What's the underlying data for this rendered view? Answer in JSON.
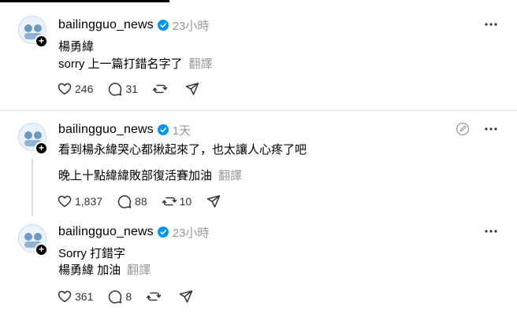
{
  "colors": {
    "verified": "#0095f6",
    "muted": "#999999",
    "divider": "#dcdcdc"
  },
  "posts": [
    {
      "username": "bailingguo_news",
      "time": "23小時",
      "lines": [
        "楊勇緯",
        "sorry 上一篇打錯名字了"
      ],
      "translate": "翻譯",
      "likes": "246",
      "comments": "31",
      "reposts": "",
      "has_compose_icon": false
    },
    {
      "username": "bailingguo_news",
      "time": "1天",
      "lines": [
        "看到楊永緯哭心都揪起來了，也太讓人心疼了吧",
        "晚上十點緯緯敗部復活賽加油"
      ],
      "translate": "翻譯",
      "likes": "1,837",
      "comments": "88",
      "reposts": "10",
      "has_compose_icon": true
    },
    {
      "username": "bailingguo_news",
      "time": "23小時",
      "lines": [
        "Sorry 打錯字",
        "楊勇緯 加油"
      ],
      "translate": "翻譯",
      "likes": "361",
      "comments": "8",
      "reposts": "",
      "has_compose_icon": false
    }
  ],
  "icons": [
    "avatar-icon",
    "plus-icon",
    "verified-badge-icon",
    "more-icon",
    "heart-icon",
    "comment-icon",
    "repost-icon",
    "share-icon",
    "compose-icon"
  ]
}
